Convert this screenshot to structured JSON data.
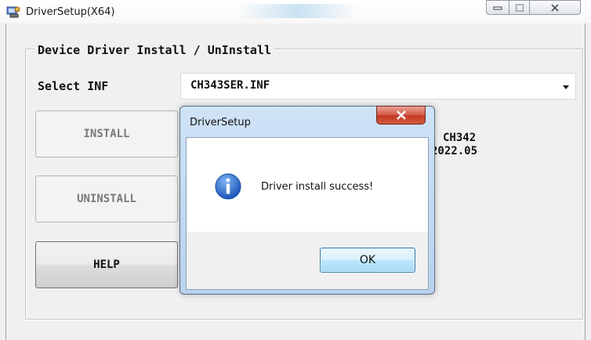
{
  "window": {
    "title": "DriverSetup(X64)",
    "icons": {
      "app": "driver-setup-icon",
      "minimize": "minimize-icon",
      "maximize": "maximize-icon",
      "close": "close-icon"
    }
  },
  "group": {
    "legend": "Device Driver Install / UnInstall"
  },
  "select_inf": {
    "label": "Select INF",
    "value": "CH343SER.INF"
  },
  "buttons": {
    "install": "INSTALL",
    "uninstall": "UNINSTALL",
    "help": "HELP"
  },
  "driver_info": {
    "name": "CH342",
    "date": "2022.05"
  },
  "dialog": {
    "title": "DriverSetup",
    "message": "Driver install success!",
    "ok": "OK",
    "icons": {
      "info": "information-icon",
      "close": "close-icon"
    }
  },
  "colors": {
    "close_red": "#c23a25",
    "dialog_frame": "#cfe2f6",
    "info_blue": "#1f67c9"
  }
}
